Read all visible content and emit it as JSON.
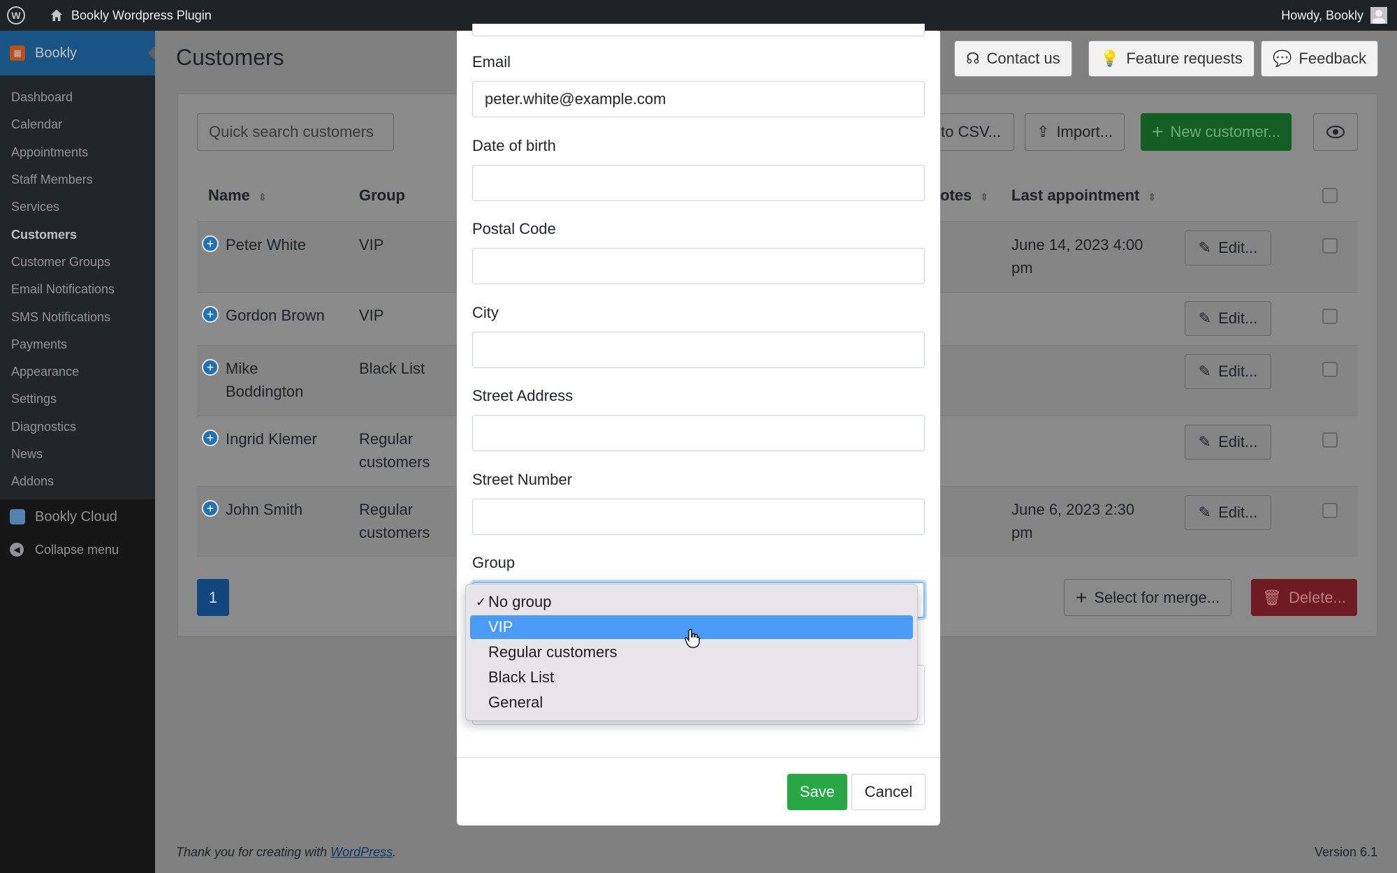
{
  "adminbar": {
    "site_name": "Bookly Wordpress Plugin",
    "howdy": "Howdy, Bookly"
  },
  "sidebar": {
    "plugin": "Bookly",
    "items": [
      "Dashboard",
      "Calendar",
      "Appointments",
      "Staff Members",
      "Services",
      "Customers",
      "Customer Groups",
      "Email Notifications",
      "SMS Notifications",
      "Payments",
      "Appearance",
      "Settings",
      "Diagnostics",
      "News",
      "Addons"
    ],
    "active": "Customers",
    "cloud": "Bookly Cloud",
    "collapse": "Collapse menu"
  },
  "page": {
    "title": "Customers",
    "contact": "Contact us",
    "feature": "Feature requests",
    "feedback": "Feedback",
    "search_placeholder": "Quick search customers",
    "export": "to CSV...",
    "import": "Import...",
    "new_customer": "New customer...",
    "select_merge": "Select for merge...",
    "delete": "Delete...",
    "page_number": "1"
  },
  "table": {
    "headers": {
      "name": "Name",
      "group": "Group",
      "notes": "otes",
      "last": "Last appointment"
    },
    "edit_label": "Edit...",
    "rows": [
      {
        "name": "Peter White",
        "group": "VIP",
        "last": "June 14, 2023 4:00 pm"
      },
      {
        "name": "Gordon Brown",
        "group": "VIP",
        "last": ""
      },
      {
        "name": "Mike Boddington",
        "group": "Black List",
        "last": ""
      },
      {
        "name": "Ingrid Klemer",
        "group": "Regular customers",
        "last": ""
      },
      {
        "name": "John Smith",
        "group": "Regular customers",
        "last": "June 6, 2023 2:30 pm"
      }
    ]
  },
  "modal": {
    "email_label": "Email",
    "email_value": "peter.white@example.com",
    "dob_label": "Date of birth",
    "postal_label": "Postal Code",
    "city_label": "City",
    "street_label": "Street Address",
    "number_label": "Street Number",
    "group_label": "Group",
    "save": "Save",
    "cancel": "Cancel"
  },
  "dropdown": {
    "options": [
      "No group",
      "VIP",
      "Regular customers",
      "Black List",
      "General"
    ],
    "checked": "No group",
    "highlighted": "VIP"
  },
  "footer": {
    "thanks_prefix": "Thank you for creating with ",
    "wordpress": "WordPress",
    "thanks_suffix": ".",
    "version": "Version 6.1"
  },
  "colors": {
    "primary": "#2271b1",
    "success": "#28a745",
    "danger": "#dc3545",
    "highlight": "#4a9bf7"
  }
}
